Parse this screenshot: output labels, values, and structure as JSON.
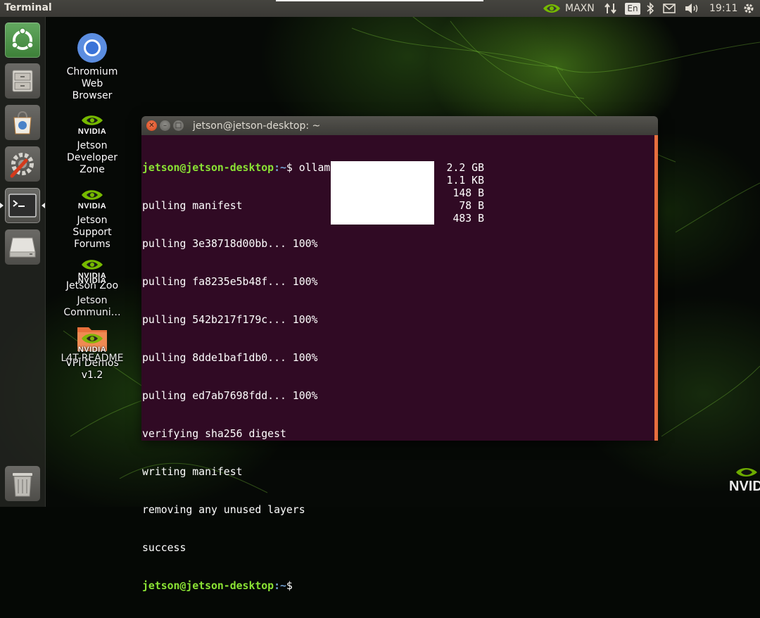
{
  "top_panel": {
    "app_title": "Terminal",
    "power_mode": "MAXN",
    "keyboard_layout": "En",
    "clock": "19:11"
  },
  "launcher": {
    "items": [
      {
        "name": "ubuntu-dash",
        "icon": "ubuntu-logo-icon"
      },
      {
        "name": "files",
        "icon": "file-cabinet-icon"
      },
      {
        "name": "ubuntu-software",
        "icon": "shopping-bag-icon"
      },
      {
        "name": "system-settings",
        "icon": "gear-wrench-icon"
      },
      {
        "name": "terminal",
        "icon": "terminal-icon",
        "active": true
      },
      {
        "name": "drive",
        "icon": "hard-drive-icon"
      },
      {
        "name": "trash",
        "icon": "trash-icon"
      }
    ]
  },
  "desktop": {
    "icons": [
      {
        "label": "Chromium Web Browser",
        "icon": "chromium-icon"
      },
      {
        "label": "Jetson Developer Zone",
        "icon": "nvidia-logo-icon",
        "logo_text": "NVIDIA"
      },
      {
        "label": "Jetson Support Forums",
        "icon": "nvidia-logo-icon",
        "logo_text": "NVIDIA"
      },
      {
        "label": "Jetson Zoo",
        "icon": "nvidia-logo-icon",
        "logo_text": "NVIDIA"
      },
      {
        "label": "Jetson Communi…",
        "icon": "nvidia-logo-icon",
        "logo_text": "NVIDIA"
      },
      {
        "label": "VPI Demos v1.2",
        "icon": "folder-icon"
      },
      {
        "label": "L4T-README",
        "icon": "nvidia-logo-icon",
        "logo_text": "NVIDIA"
      }
    ],
    "corner_logo_text": "NVID"
  },
  "terminal": {
    "window_title": "jetson@jetson-desktop: ~",
    "prompt_user": "jetson@jetson-desktop",
    "prompt_path": ":~",
    "prompt_symbol": "$ ",
    "command": "ollama pull phi3:3.8b",
    "output": [
      "pulling manifest",
      "pulling 3e38718d00bb... 100%",
      "pulling fa8235e5b48f... 100%",
      "pulling 542b217f179c... 100%",
      "pulling 8dde1baf1db0... 100%",
      "pulling ed7ab7698fdd... 100%",
      "verifying sha256 digest",
      "writing manifest",
      "removing any unused layers",
      "success"
    ],
    "sizes": [
      "2.2 GB",
      "1.1 KB",
      "148 B",
      "78 B",
      "483 B"
    ],
    "colors": {
      "background": "#300a24",
      "prompt_user": "#8ae234",
      "prompt_path": "#729fcf",
      "scrollbar": "#e76e3e"
    }
  }
}
